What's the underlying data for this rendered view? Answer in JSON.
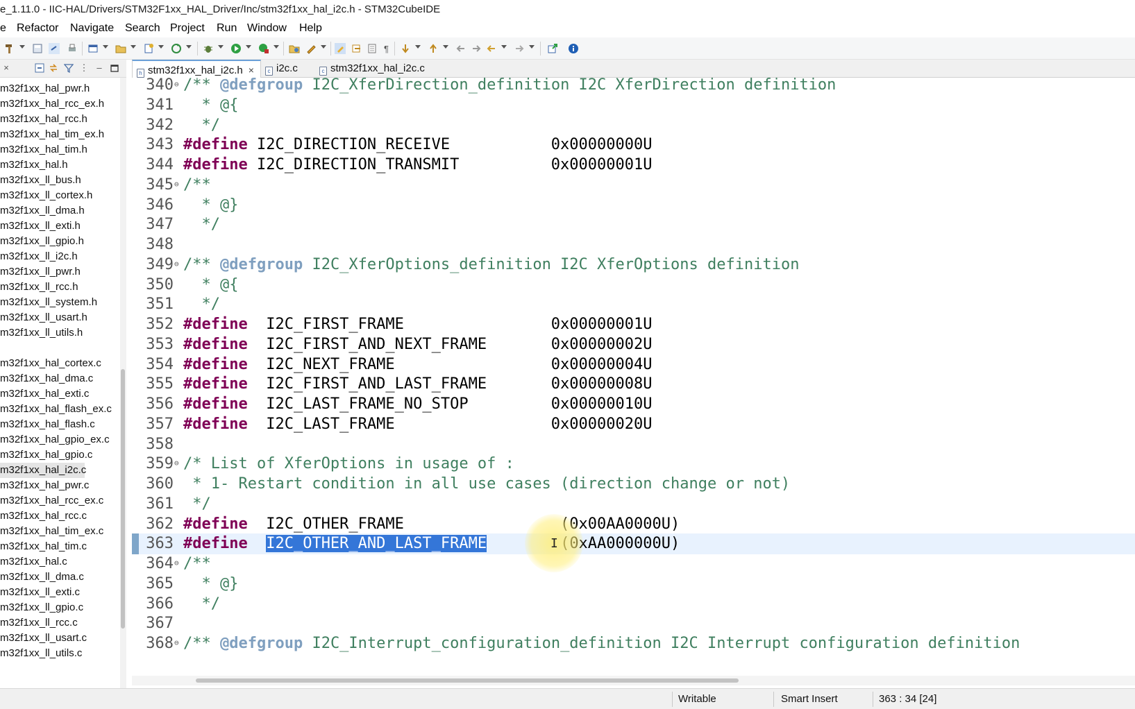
{
  "window": {
    "title": "e_1.11.0 - IIC-HAL/Drivers/STM32F1xx_HAL_Driver/Inc/stm32f1xx_hal_i2c.h - STM32CubeIDE"
  },
  "menu": [
    "e",
    "Refactor",
    "Navigate",
    "Search",
    "Project",
    "Run",
    "Window",
    "Help"
  ],
  "toolbar": {
    "icons": [
      "hammer-icon",
      "save-icon",
      "link-icon",
      "print-icon",
      "new-window-icon",
      "open-type-icon",
      "new-file-icon",
      "refresh-icon",
      "debug-bug-icon",
      "run-icon",
      "run-config-icon",
      "open-folder-icon",
      "pencil-icon",
      "highlight-icon",
      "toggle-mark-icon",
      "block-select-icon",
      "paragraph-icon",
      "next-annotation-icon",
      "prev-annotation-icon",
      "back-edit-icon",
      "forward-edit-icon",
      "back-icon",
      "forward-icon",
      "external-icon",
      "info-icon"
    ]
  },
  "left_panel": {
    "close_label": "×",
    "files": [
      {
        "name": "m32f1xx_hal_pwr.h",
        "selected": false
      },
      {
        "name": "m32f1xx_hal_rcc_ex.h",
        "selected": false
      },
      {
        "name": "m32f1xx_hal_rcc.h",
        "selected": false
      },
      {
        "name": "m32f1xx_hal_tim_ex.h",
        "selected": false
      },
      {
        "name": "m32f1xx_hal_tim.h",
        "selected": false
      },
      {
        "name": "m32f1xx_hal.h",
        "selected": false
      },
      {
        "name": "m32f1xx_ll_bus.h",
        "selected": false
      },
      {
        "name": "m32f1xx_ll_cortex.h",
        "selected": false
      },
      {
        "name": "m32f1xx_ll_dma.h",
        "selected": false
      },
      {
        "name": "m32f1xx_ll_exti.h",
        "selected": false
      },
      {
        "name": "m32f1xx_ll_gpio.h",
        "selected": false
      },
      {
        "name": "m32f1xx_ll_i2c.h",
        "selected": false
      },
      {
        "name": "m32f1xx_ll_pwr.h",
        "selected": false
      },
      {
        "name": "m32f1xx_ll_rcc.h",
        "selected": false
      },
      {
        "name": "m32f1xx_ll_system.h",
        "selected": false
      },
      {
        "name": "m32f1xx_ll_usart.h",
        "selected": false
      },
      {
        "name": "m32f1xx_ll_utils.h",
        "selected": false
      },
      {
        "name": "",
        "selected": false
      },
      {
        "name": "m32f1xx_hal_cortex.c",
        "selected": false
      },
      {
        "name": "m32f1xx_hal_dma.c",
        "selected": false
      },
      {
        "name": "m32f1xx_hal_exti.c",
        "selected": false
      },
      {
        "name": "m32f1xx_hal_flash_ex.c",
        "selected": false
      },
      {
        "name": "m32f1xx_hal_flash.c",
        "selected": false
      },
      {
        "name": "m32f1xx_hal_gpio_ex.c",
        "selected": false
      },
      {
        "name": "m32f1xx_hal_gpio.c",
        "selected": false
      },
      {
        "name": "m32f1xx_hal_i2c.c",
        "selected": true
      },
      {
        "name": "m32f1xx_hal_pwr.c",
        "selected": false
      },
      {
        "name": "m32f1xx_hal_rcc_ex.c",
        "selected": false
      },
      {
        "name": "m32f1xx_hal_rcc.c",
        "selected": false
      },
      {
        "name": "m32f1xx_hal_tim_ex.c",
        "selected": false
      },
      {
        "name": "m32f1xx_hal_tim.c",
        "selected": false
      },
      {
        "name": "m32f1xx_hal.c",
        "selected": false
      },
      {
        "name": "m32f1xx_ll_dma.c",
        "selected": false
      },
      {
        "name": "m32f1xx_ll_exti.c",
        "selected": false
      },
      {
        "name": "m32f1xx_ll_gpio.c",
        "selected": false
      },
      {
        "name": "m32f1xx_ll_rcc.c",
        "selected": false
      },
      {
        "name": "m32f1xx_ll_usart.c",
        "selected": false
      },
      {
        "name": "m32f1xx_ll_utils.c",
        "selected": false
      }
    ]
  },
  "tabs": [
    {
      "label": "stm32f1xx_hal_i2c.h",
      "active": true,
      "closable": true,
      "close_label": "×"
    },
    {
      "label": "i2c.c",
      "active": false,
      "closable": false
    },
    {
      "label": "stm32f1xx_hal_i2c.c",
      "active": false,
      "closable": false
    }
  ],
  "editor": {
    "lines": [
      {
        "num": "340",
        "fold": true,
        "parts": [
          [
            "c-comment",
            "/** "
          ],
          [
            "c-tag",
            "@defgroup"
          ],
          [
            "c-comment",
            " I2C_XferDirection_definition I2C XferDirection definition"
          ]
        ]
      },
      {
        "num": "341",
        "fold": false,
        "parts": [
          [
            "c-comment",
            "  * @{"
          ]
        ]
      },
      {
        "num": "342",
        "fold": false,
        "parts": [
          [
            "c-comment",
            "  */"
          ]
        ]
      },
      {
        "num": "343",
        "fold": false,
        "parts": [
          [
            "c-define",
            "#define"
          ],
          [
            "c-macro",
            " I2C_DIRECTION_RECEIVE           0x00000000U"
          ]
        ]
      },
      {
        "num": "344",
        "fold": false,
        "parts": [
          [
            "c-define",
            "#define"
          ],
          [
            "c-macro",
            " I2C_DIRECTION_TRANSMIT          0x00000001U"
          ]
        ]
      },
      {
        "num": "345",
        "fold": true,
        "parts": [
          [
            "c-comment",
            "/**"
          ]
        ]
      },
      {
        "num": "346",
        "fold": false,
        "parts": [
          [
            "c-comment",
            "  * @}"
          ]
        ]
      },
      {
        "num": "347",
        "fold": false,
        "parts": [
          [
            "c-comment",
            "  */"
          ]
        ]
      },
      {
        "num": "348",
        "fold": false,
        "parts": []
      },
      {
        "num": "349",
        "fold": true,
        "parts": [
          [
            "c-comment",
            "/** "
          ],
          [
            "c-tag",
            "@defgroup"
          ],
          [
            "c-comment",
            " I2C_XferOptions_definition I2C XferOptions definition"
          ]
        ]
      },
      {
        "num": "350",
        "fold": false,
        "parts": [
          [
            "c-comment",
            "  * @{"
          ]
        ]
      },
      {
        "num": "351",
        "fold": false,
        "parts": [
          [
            "c-comment",
            "  */"
          ]
        ]
      },
      {
        "num": "352",
        "fold": false,
        "parts": [
          [
            "c-define",
            "#define"
          ],
          [
            "c-macro",
            "  I2C_FIRST_FRAME                0x00000001U"
          ]
        ]
      },
      {
        "num": "353",
        "fold": false,
        "parts": [
          [
            "c-define",
            "#define"
          ],
          [
            "c-macro",
            "  I2C_FIRST_AND_NEXT_FRAME       0x00000002U"
          ]
        ]
      },
      {
        "num": "354",
        "fold": false,
        "parts": [
          [
            "c-define",
            "#define"
          ],
          [
            "c-macro",
            "  I2C_NEXT_FRAME                 0x00000004U"
          ]
        ]
      },
      {
        "num": "355",
        "fold": false,
        "parts": [
          [
            "c-define",
            "#define"
          ],
          [
            "c-macro",
            "  I2C_FIRST_AND_LAST_FRAME       0x00000008U"
          ]
        ]
      },
      {
        "num": "356",
        "fold": false,
        "parts": [
          [
            "c-define",
            "#define"
          ],
          [
            "c-macro",
            "  I2C_LAST_FRAME_NO_STOP         0x00000010U"
          ]
        ]
      },
      {
        "num": "357",
        "fold": false,
        "parts": [
          [
            "c-define",
            "#define"
          ],
          [
            "c-macro",
            "  I2C_LAST_FRAME                 0x00000020U"
          ]
        ]
      },
      {
        "num": "358",
        "fold": false,
        "parts": []
      },
      {
        "num": "359",
        "fold": true,
        "parts": [
          [
            "c-comment",
            "/* List of XferOptions in usage of :"
          ]
        ]
      },
      {
        "num": "360",
        "fold": false,
        "parts": [
          [
            "c-comment",
            " * 1- Restart condition in all use cases (direction change or not)"
          ]
        ]
      },
      {
        "num": "361",
        "fold": false,
        "parts": [
          [
            "c-comment",
            " */"
          ]
        ]
      },
      {
        "num": "362",
        "fold": false,
        "parts": [
          [
            "c-define",
            "#define"
          ],
          [
            "c-macro",
            "  I2C_OTHER_FRAME                 (0x00AA0000U)"
          ]
        ]
      },
      {
        "num": "363",
        "fold": false,
        "current": true,
        "parts": [
          [
            "c-define",
            "#define"
          ],
          [
            "c-macro",
            "  "
          ],
          [
            "c-sel",
            "I2C_OTHER_AND_LAST_FRAME"
          ],
          [
            "c-macro",
            "        (0xAA000000U)"
          ]
        ]
      },
      {
        "num": "364",
        "fold": true,
        "parts": [
          [
            "c-comment",
            "/**"
          ]
        ]
      },
      {
        "num": "365",
        "fold": false,
        "parts": [
          [
            "c-comment",
            "  * @}"
          ]
        ]
      },
      {
        "num": "366",
        "fold": false,
        "parts": [
          [
            "c-comment",
            "  */"
          ]
        ]
      },
      {
        "num": "367",
        "fold": false,
        "parts": []
      },
      {
        "num": "368",
        "fold": true,
        "parts": [
          [
            "c-comment",
            "/** "
          ],
          [
            "c-tag",
            "@defgroup"
          ],
          [
            "c-comment",
            " I2C_Interrupt_configuration_definition I2C Interrupt configuration definition"
          ]
        ]
      }
    ],
    "ibeam_glyph": "I"
  },
  "status": {
    "writable": "Writable",
    "insert_mode": "Smart Insert",
    "position": "363 : 34 [24]"
  },
  "colors": {
    "keyword": "#7f0055",
    "comment": "#3f7f5f",
    "javadoc_tag": "#7f9fbf",
    "selection": "#3476d8",
    "current_line": "#e8f2fe"
  }
}
